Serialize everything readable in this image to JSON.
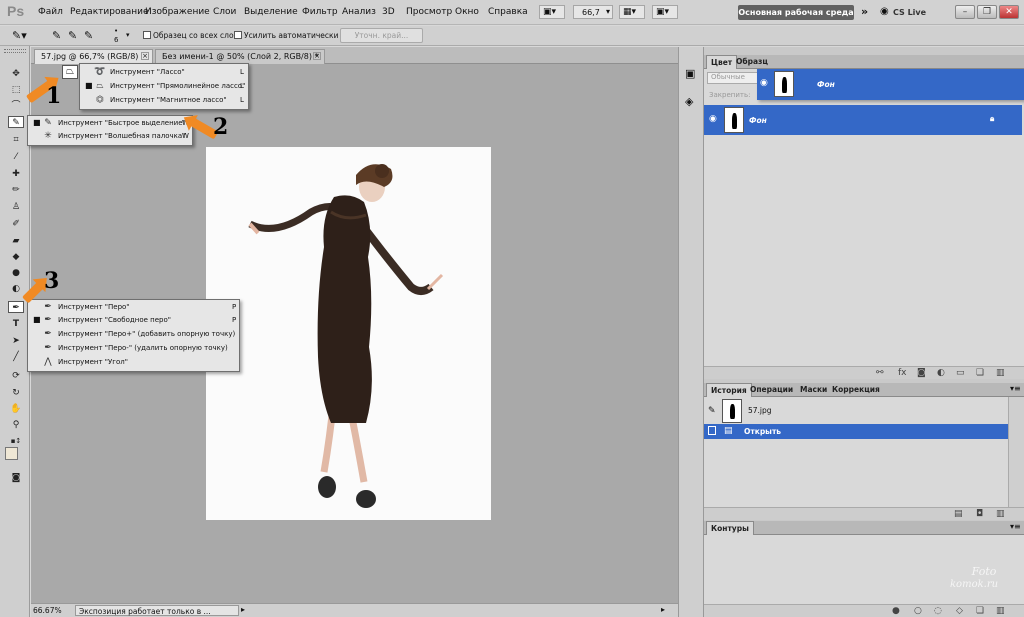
{
  "app": {
    "logo": "Ps",
    "menu": [
      "Файл",
      "Редактирование",
      "Изображение",
      "Слои",
      "Выделение",
      "Фильтр",
      "Анализ",
      "3D",
      "Просмотр",
      "Окно",
      "Справка"
    ],
    "zoom_value": "66,7",
    "workspace": "Основная рабочая среда",
    "cs_live": "CS Live"
  },
  "options_bar": {
    "brush_size": "6",
    "sample_all_layers": "Образец со всех слоев",
    "auto_enhance": "Усилить автоматически",
    "refine_edge": "Уточн. край..."
  },
  "tabs": [
    {
      "label": "57.jpg @ 66,7% (RGB/8)"
    },
    {
      "label": "Без имени-1 @ 50% (Слой 2, RGB/8) *"
    }
  ],
  "flyouts": {
    "lasso": [
      {
        "label": "Инструмент \"Лассо\"",
        "key": "L",
        "selected": false
      },
      {
        "label": "Инструмент \"Прямолинейное лассо\"",
        "key": "L",
        "selected": true
      },
      {
        "label": "Инструмент \"Магнитное лассо\"",
        "key": "L",
        "selected": false
      }
    ],
    "quick": [
      {
        "label": "Инструмент \"Быстрое выделение\"",
        "key": "W",
        "selected": true
      },
      {
        "label": "Инструмент \"Волшебная палочка\"",
        "key": "W",
        "selected": false
      }
    ],
    "pen": [
      {
        "label": "Инструмент \"Перо\"",
        "key": "P",
        "selected": false
      },
      {
        "label": "Инструмент \"Свободное перо\"",
        "key": "P",
        "selected": true
      },
      {
        "label": "Инструмент \"Перо+\" (добавить опорную точку)",
        "key": "",
        "selected": false
      },
      {
        "label": "Инструмент \"Перо-\" (удалить опорную точку)",
        "key": "",
        "selected": false
      },
      {
        "label": "Инструмент \"Угол\"",
        "key": "",
        "selected": false
      }
    ]
  },
  "callouts": [
    "1",
    "2",
    "3"
  ],
  "status": {
    "zoom": "66.67%",
    "info": "Экспозиция работает только в ..."
  },
  "layers_panel": {
    "tabs": [
      "Цвет",
      "Образц"
    ],
    "blend_mode": "Обычные",
    "lock_label": "Закрепить:",
    "dragged_layer": "Фон",
    "layer_name": "Фон"
  },
  "history_panel": {
    "tabs": [
      "История",
      "Операции",
      "Маски",
      "Коррекция"
    ],
    "snapshot": "57.jpg",
    "step": "Открыть"
  },
  "paths_panel": {
    "tab": "Контуры"
  },
  "watermark": {
    "line1": "Foto",
    "line2": "komok.ru"
  },
  "colors": {
    "selection": "#3468c7",
    "arrow": "#f08a24",
    "canvas_bg": "#a9a9a9"
  }
}
